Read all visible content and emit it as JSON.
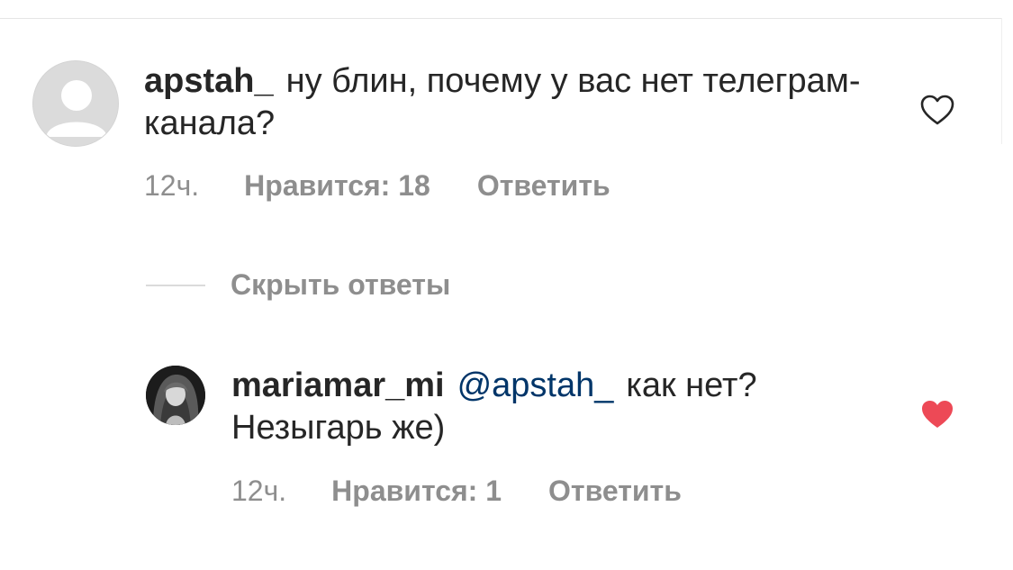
{
  "comments": [
    {
      "username": "apstah_",
      "text": "ну блин, почему у вас нет телеграм-канала?",
      "time": "12ч.",
      "likes_label": "Нравится: 18",
      "reply_label": "Ответить",
      "liked": false,
      "avatar": "default-user-avatar"
    },
    {
      "username": "mariamar_mi",
      "mention": "@apstah_",
      "text": "как нет? Незыгарь же)",
      "time": "12ч.",
      "likes_label": "Нравится: 1",
      "reply_label": "Ответить",
      "liked": true,
      "avatar": "profile-photo"
    }
  ],
  "replies_toggle_label": "Скрыть ответы",
  "colors": {
    "text": "#262626",
    "secondary": "#8e8e8e",
    "mention": "#003569",
    "liked_heart": "#ed4956",
    "heart_outline": "#262626"
  },
  "icons": {
    "like_empty": "heart-outline-icon",
    "like_filled": "heart-filled-icon"
  }
}
